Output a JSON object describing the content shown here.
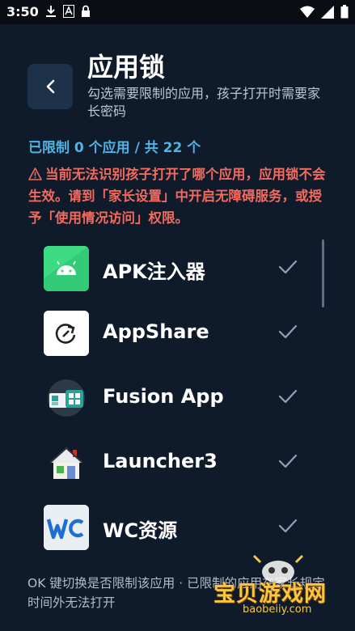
{
  "status_bar": {
    "time": "3:50",
    "left_icons": [
      "download-icon",
      "font-icon",
      "lock-icon"
    ],
    "right_icons": [
      "wifi-icon",
      "signal-icon",
      "battery-icon"
    ]
  },
  "header": {
    "back_label": "<",
    "title": "应用锁",
    "subtitle": "勾选需要限制的应用，孩子打开时需要家长密码"
  },
  "summary": {
    "count_text": "已限制 0 个应用 / 共 22 个"
  },
  "warning": {
    "text": "当前无法识别孩子打开了哪个应用，应用锁不会生效。请到「家长设置」中开启无障碍服务，或授予「使用情况访问」权限。"
  },
  "apps": [
    {
      "name": "APK注入器",
      "icon": "android-icon",
      "checked": true
    },
    {
      "name": "AppShare",
      "icon": "share-refresh-icon",
      "checked": true
    },
    {
      "name": "Fusion App",
      "icon": "fusion-app-icon",
      "checked": true
    },
    {
      "name": "Launcher3",
      "icon": "house-icon",
      "checked": true
    },
    {
      "name": "WC资源",
      "icon": "wc-logo-icon",
      "checked": true
    }
  ],
  "footer": {
    "text": "OK 键切换是否限制该应用 · 已限制的应用在家长规定时间外无法打开"
  },
  "watermark": {
    "title": "宝贝游戏网",
    "url": "baobeiiy.com"
  },
  "colors": {
    "background": "#0f1b2a",
    "accent": "#4fb3e6",
    "warning": "#f26a5e",
    "check": "#8fa3b8"
  }
}
